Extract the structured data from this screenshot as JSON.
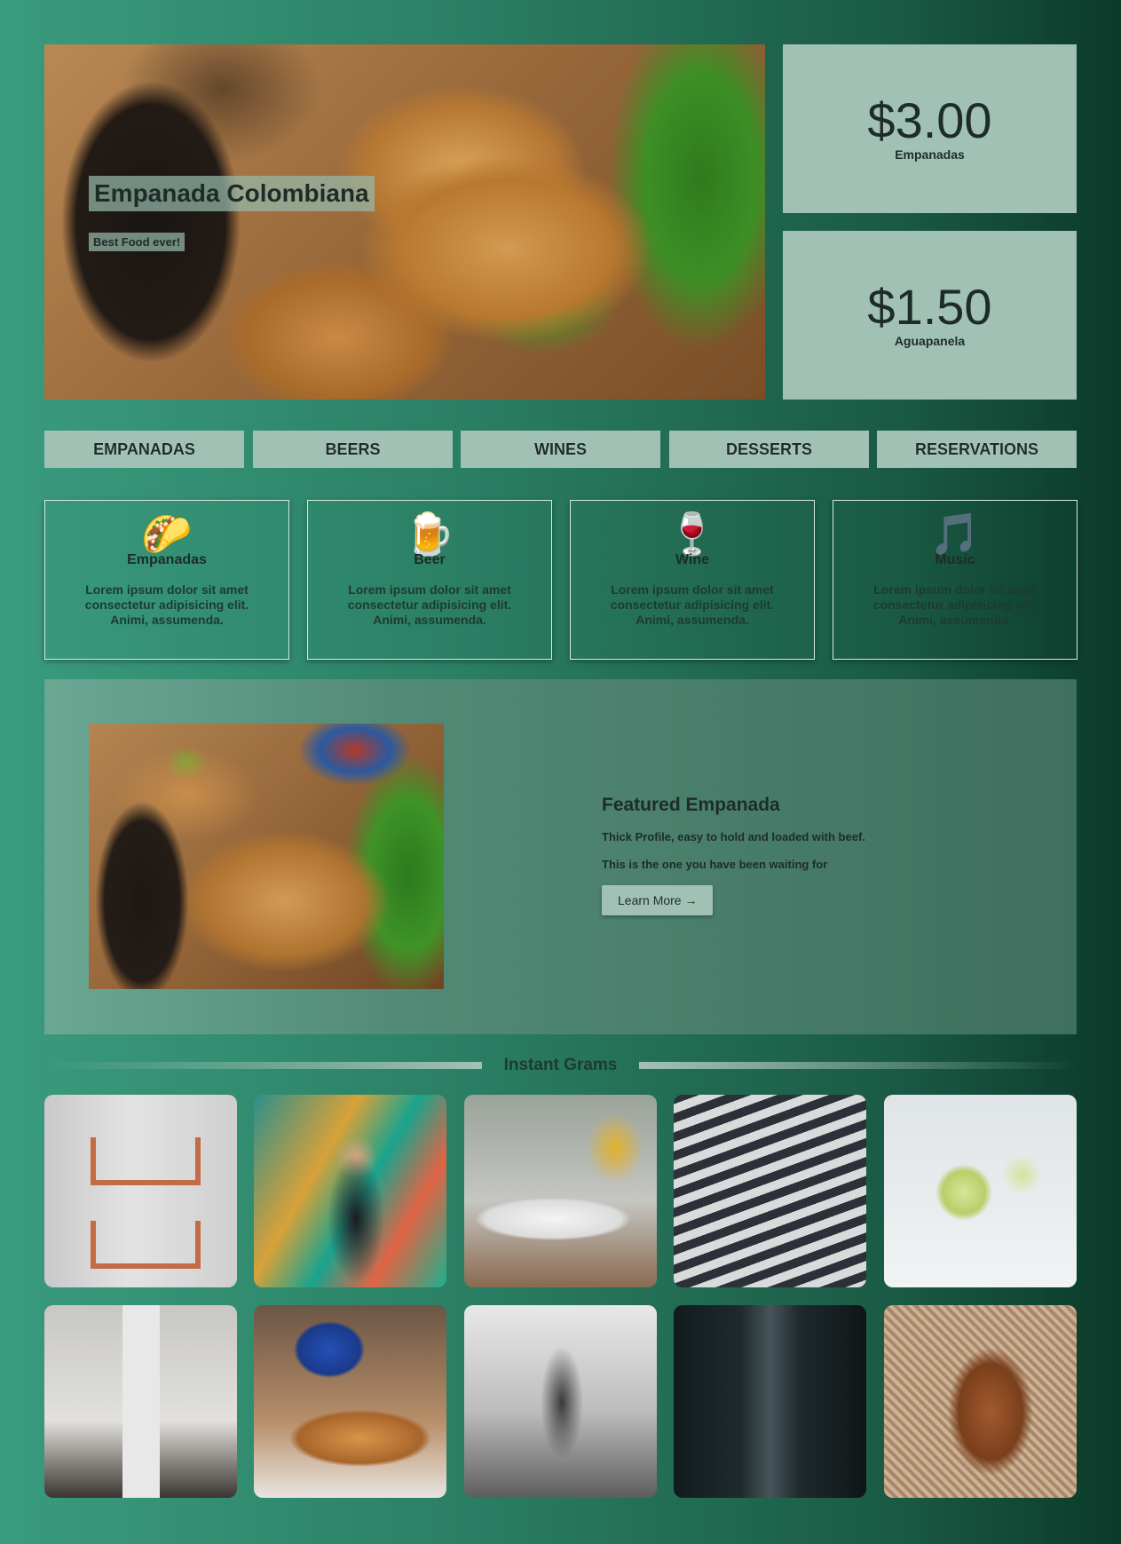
{
  "hero": {
    "title": "Empanada Colombiana",
    "subtitle": "Best Food ever!",
    "prices": [
      {
        "amount": "$3.00",
        "label": "Empanadas"
      },
      {
        "amount": "$1.50",
        "label": "Aguapanela"
      }
    ]
  },
  "nav": {
    "items": [
      "EMPANADAS",
      "BEERS",
      "WINES",
      "DESSERTS",
      "RESERVATIONS"
    ]
  },
  "cards": [
    {
      "icon": "🌮",
      "icon_name": "taco-icon",
      "title": "Empanadas",
      "text": "Lorem ipsum dolor sit amet consectetur adipisicing elit. Animi, assumenda."
    },
    {
      "icon": "🍺",
      "icon_name": "beer-mug-icon",
      "title": "Beer",
      "text": "Lorem ipsum dolor sit amet consectetur adipisicing elit. Animi, assumenda."
    },
    {
      "icon": "🍷",
      "icon_name": "wine-glass-icon",
      "title": "Wine",
      "text": "Lorem ipsum dolor sit amet consectetur adipisicing elit. Animi, assumenda."
    },
    {
      "icon": "🎵",
      "icon_name": "music-note-icon",
      "title": "Music",
      "text": "Lorem ipsum dolor sit amet consectetur adipisicing elit. Animi, assumenda."
    }
  ],
  "featured": {
    "title": "Featured Empanada",
    "line1": "Thick Profile, easy to hold and loaded with beef.",
    "line2": "This is the one you have been waiting for",
    "button": "Learn More →"
  },
  "grams": {
    "title": "Instant Grams"
  },
  "colors": {
    "card_bg": "#a2c1b5",
    "bg_start": "#3a9b7e",
    "bg_end": "#0b3a2a"
  }
}
